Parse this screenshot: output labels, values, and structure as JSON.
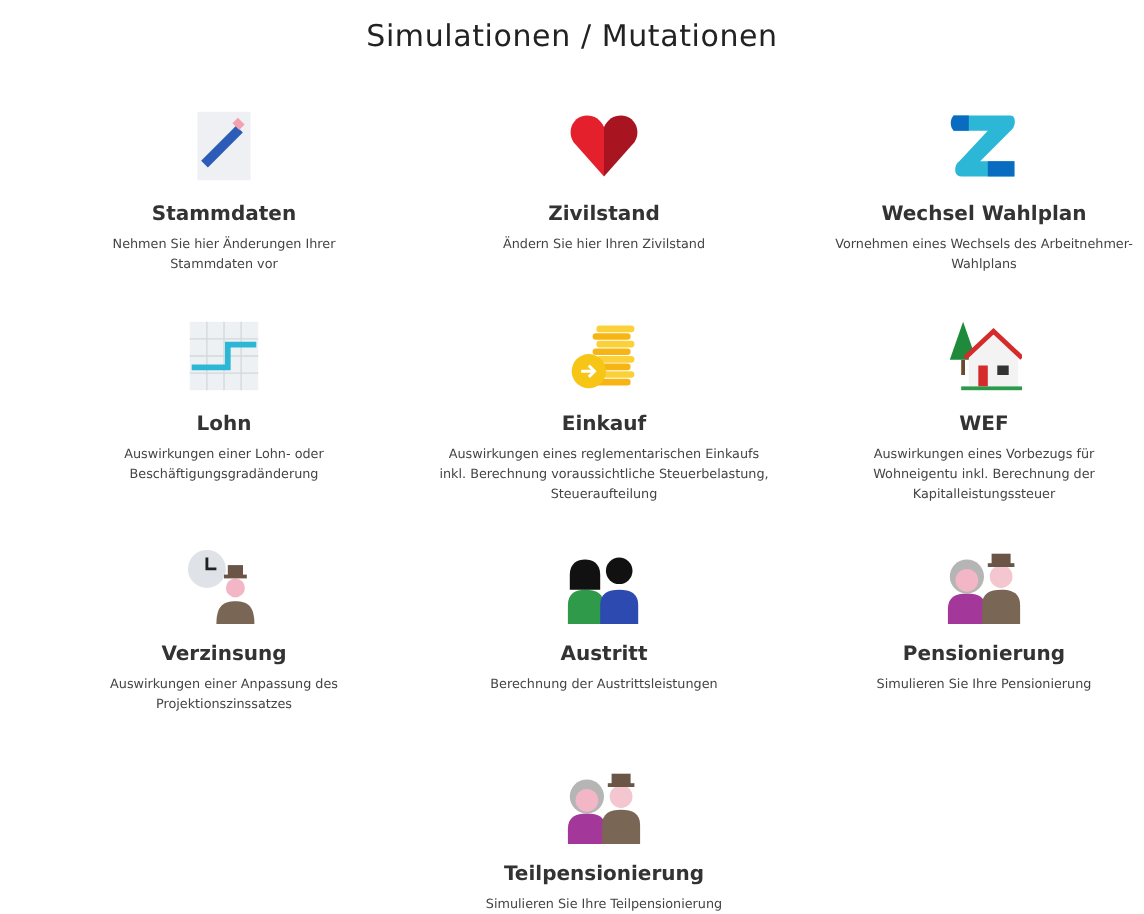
{
  "title": "Simulationen / Mutationen",
  "items": [
    {
      "kind": "document",
      "title": "Stammdaten",
      "description": "Nehmen Sie hier Änderungen Ihrer Stammdaten vor"
    },
    {
      "kind": "heart",
      "title": "Zivilstand",
      "description": "Ändern Sie hier Ihren Zivilstand"
    },
    {
      "kind": "ribbon",
      "title": "Wechsel Wahlplan",
      "description": "Vornehmen eines Wechsels des Arbeitnehmer-Wahlplans"
    },
    {
      "kind": "chart",
      "title": "Lohn",
      "description": "Auswirkungen einer Lohn- oder Beschäftigungsgradänderung"
    },
    {
      "kind": "coins",
      "title": "Einkauf",
      "description": "Auswirkungen eines reglementarischen Einkaufs inkl. Berechnung voraussichtliche Steuerbelastung, Steueraufteilung"
    },
    {
      "kind": "house",
      "title": "WEF",
      "description": "Auswirkungen eines Vorbezugs für Wohneigentu inkl. Berechnung der Kapitalleistungssteuer"
    },
    {
      "kind": "clock-person",
      "title": "Verzinsung",
      "description": "Auswirkungen einer Anpassung des Projektionszinssatzes"
    },
    {
      "kind": "couple",
      "title": "Austritt",
      "description": "Berechnung der Austrittsleistungen"
    },
    {
      "kind": "elderly-couple",
      "title": "Pensionierung",
      "description": "Simulieren Sie Ihre Pensionierung"
    },
    {
      "kind": "elderly-couple",
      "title": "Teilpensionierung",
      "description": "Simulieren Sie Ihre Teilpensionierung"
    }
  ]
}
